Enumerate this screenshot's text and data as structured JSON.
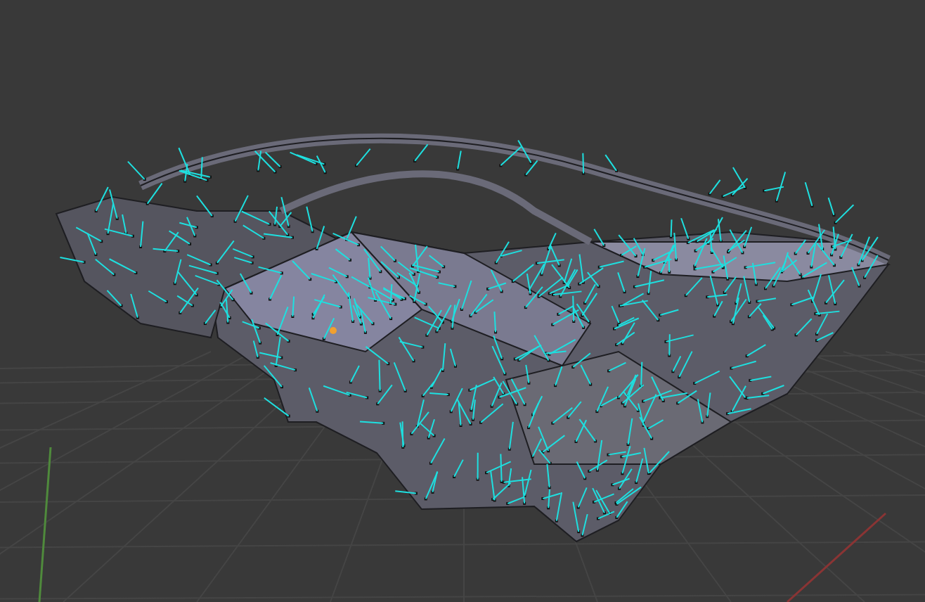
{
  "viewport": {
    "show_grid": true,
    "show_normals": true
  }
}
